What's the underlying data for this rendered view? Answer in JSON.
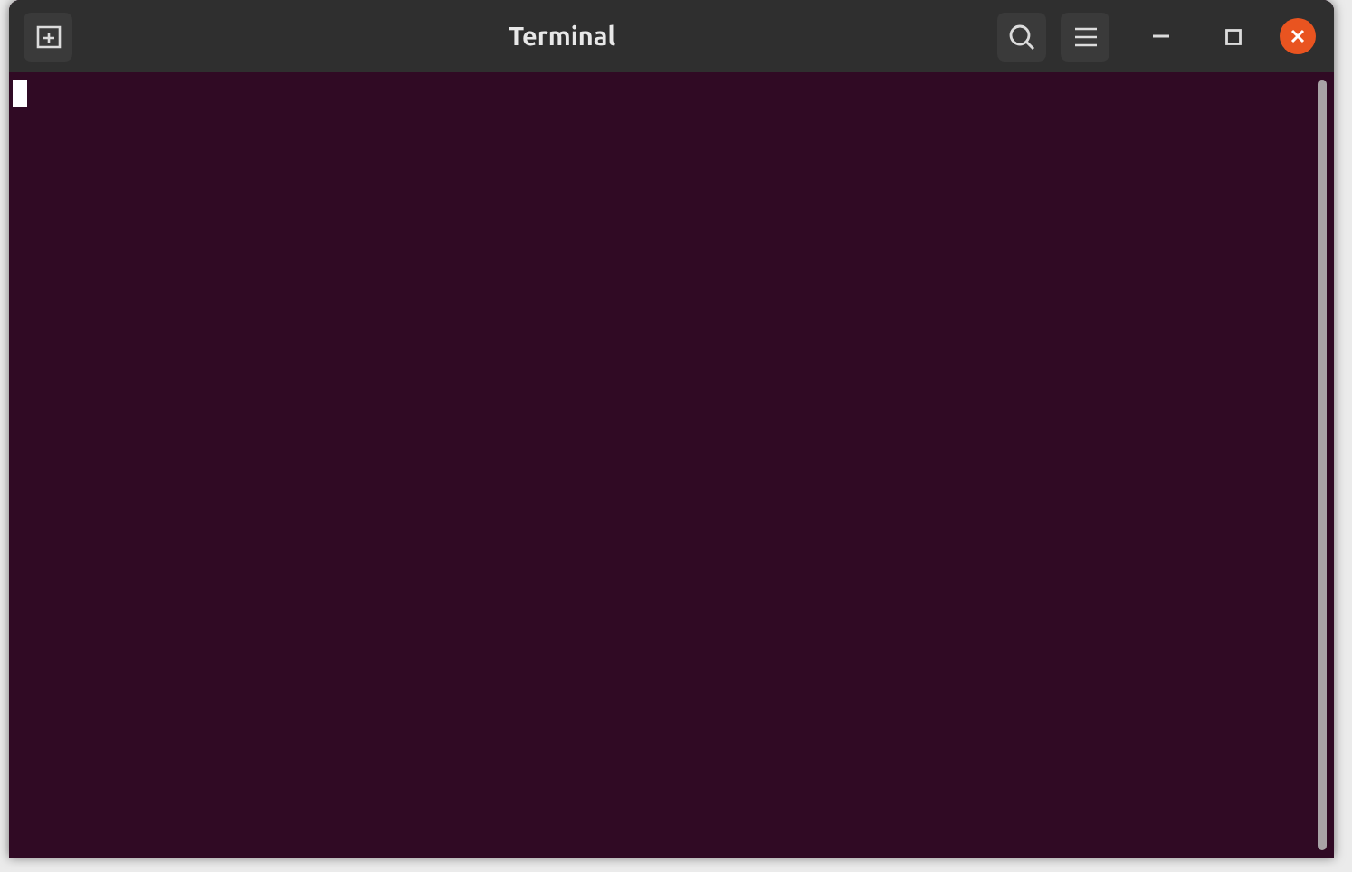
{
  "window": {
    "title": "Terminal"
  },
  "terminal": {
    "cursor_visible": true
  }
}
